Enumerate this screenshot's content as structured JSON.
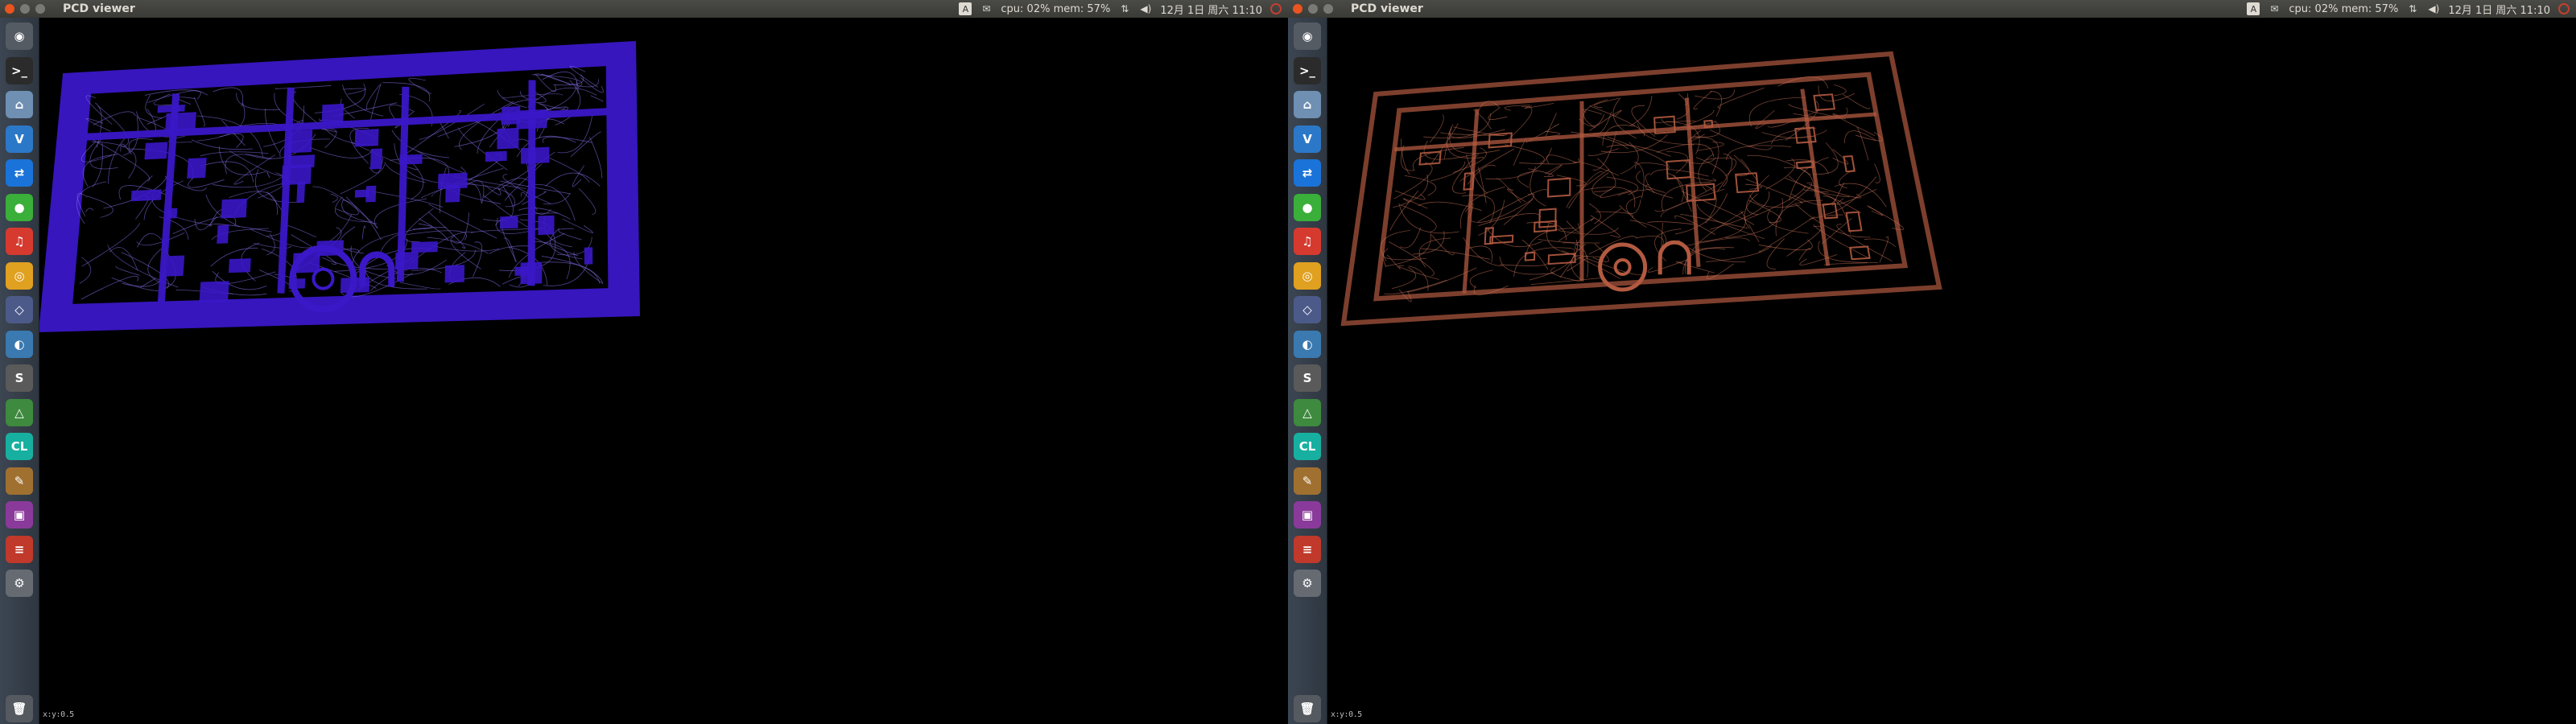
{
  "screens": [
    {
      "id": "left",
      "window_title": "PCD viewer",
      "tray": {
        "indicator": "A",
        "stats": "cpu: 02% mem: 57%",
        "datetime": "12月 1日 周六 11:10"
      },
      "viewport": {
        "cloud_color": "#3a18c8",
        "wire_color": "#8f78ff",
        "coord_label": "x:y:0.5"
      }
    },
    {
      "id": "right",
      "window_title": "PCD viewer",
      "tray": {
        "indicator": "A",
        "stats": "cpu: 02% mem: 57%",
        "datetime": "12月 1日 周六 11:10"
      },
      "viewport": {
        "cloud_color": "#b25a40",
        "wire_color": "#d4785c",
        "coord_label": "x:y:0.5"
      }
    }
  ],
  "launcher": {
    "items": [
      {
        "name": "dash-icon",
        "glyph": "◉",
        "color": "#555b63"
      },
      {
        "name": "terminal-icon",
        "glyph": ">_",
        "color": "#2b2b2b"
      },
      {
        "name": "files-icon",
        "glyph": "⌂",
        "color": "#6f8fb3"
      },
      {
        "name": "vscode-icon",
        "glyph": "V",
        "color": "#2c78c8"
      },
      {
        "name": "teamviewer-icon",
        "glyph": "⇄",
        "color": "#1a73d9"
      },
      {
        "name": "wechat-icon",
        "glyph": "●",
        "color": "#3aaf3a"
      },
      {
        "name": "netease-music-icon",
        "glyph": "♫",
        "color": "#d63a2f"
      },
      {
        "name": "chrome-icon",
        "glyph": "◎",
        "color": "#e0a020"
      },
      {
        "name": "rviz-icon",
        "glyph": "◇",
        "color": "#4c5a8a"
      },
      {
        "name": "remmina-icon",
        "glyph": "◐",
        "color": "#3a7ab0"
      },
      {
        "name": "sublime-icon",
        "glyph": "S",
        "color": "#5a5a5a"
      },
      {
        "name": "triangle-app-icon",
        "glyph": "△",
        "color": "#3e8a3e"
      },
      {
        "name": "clion-icon",
        "glyph": "CL",
        "color": "#17b0a0"
      },
      {
        "name": "gimp-icon",
        "glyph": "✎",
        "color": "#a07030"
      },
      {
        "name": "screen-recorder-icon",
        "glyph": "▣",
        "color": "#8a3a9a"
      },
      {
        "name": "mixer-icon",
        "glyph": "≡",
        "color": "#c0392b"
      },
      {
        "name": "settings-icon",
        "glyph": "⚙",
        "color": "#666b72"
      },
      {
        "name": "trash-icon",
        "glyph": "🗑",
        "color": "#555a60"
      }
    ]
  }
}
